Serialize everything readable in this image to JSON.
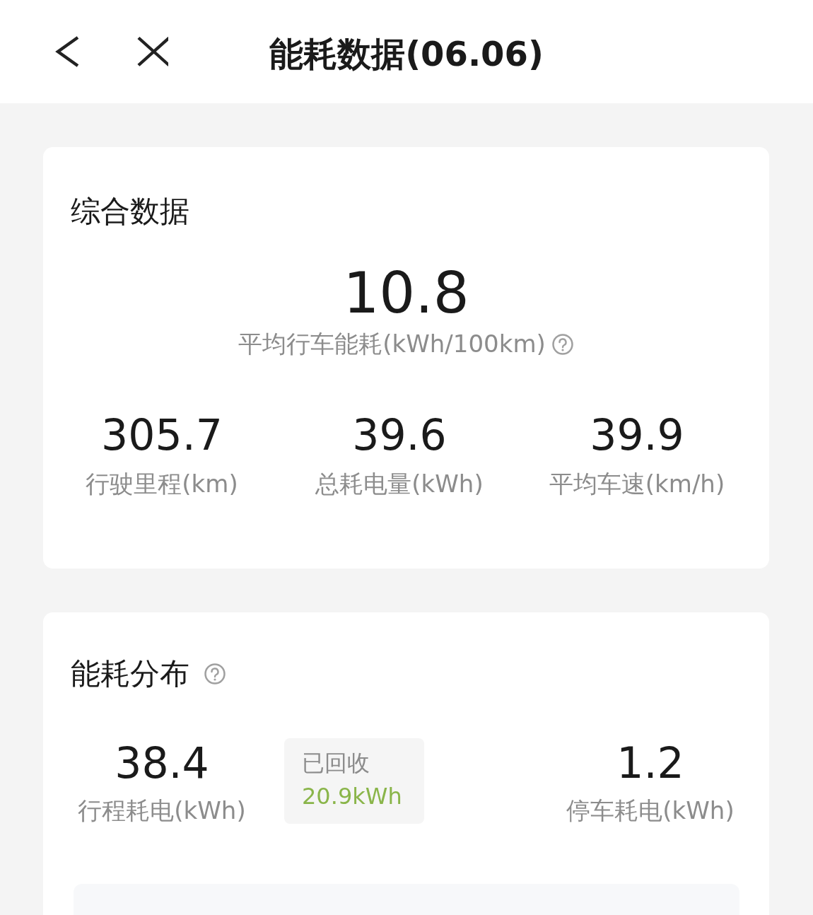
{
  "header": {
    "title": "能耗数据(06.06)"
  },
  "summary": {
    "title": "综合数据",
    "main": {
      "value": "10.8",
      "label": "平均行车能耗(kWh/100km)"
    },
    "stats": [
      {
        "value": "305.7",
        "label": "行驶里程(km)"
      },
      {
        "value": "39.6",
        "label": "总耗电量(kWh)"
      },
      {
        "value": "39.9",
        "label": "平均车速(km/h)"
      }
    ]
  },
  "distribution": {
    "title": "能耗分布",
    "stats": [
      {
        "value": "38.4",
        "label": "行程耗电(kWh)"
      },
      {
        "value": "1.2",
        "label": "停车耗电(kWh)"
      }
    ],
    "recovered": {
      "label": "已回收",
      "value": "20.9kWh"
    }
  }
}
